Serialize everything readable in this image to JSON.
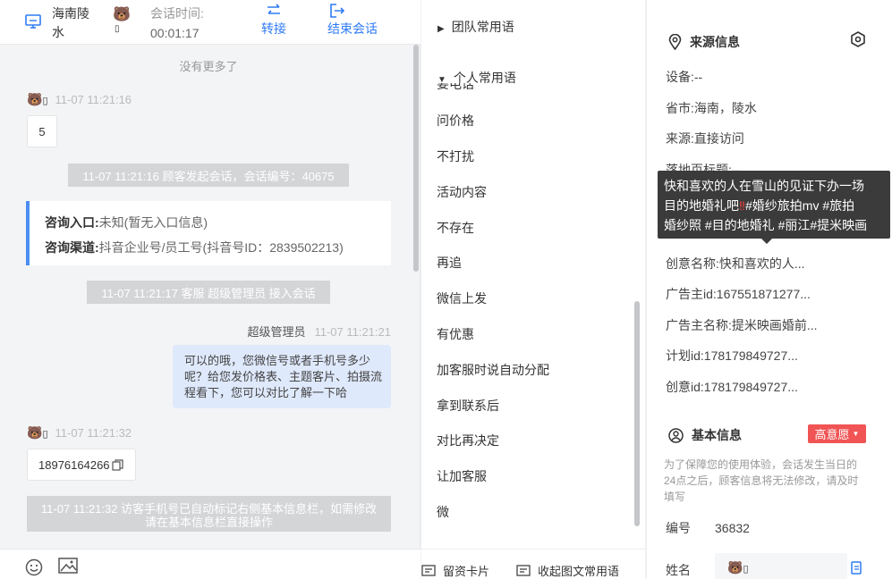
{
  "header": {
    "customer_name": "海南陵水",
    "visitor_emoji": "🐻",
    "visitor_box": "▯",
    "session_time_label": "会话时间:",
    "session_time_value": "00:01:17",
    "transfer_label": "转接",
    "end_label": "结束会话"
  },
  "chat": {
    "no_more": "没有更多了",
    "visitor_emoji": "🐻",
    "visitor_box": "▯",
    "messages": [
      {
        "time": "11-07 11:21:16",
        "text": "5"
      },
      {
        "system": "11-07 11:21:16 顾客发起会话，会话编号：40675"
      },
      {
        "entry_label": "咨询入口:",
        "entry_value": "未知(暂无入口信息)",
        "channel_label": "咨询渠道:",
        "channel_value": "抖音企业号/员工号(抖音号ID：2839502213)"
      },
      {
        "system": "11-07 11:21:17 客服 超级管理员 接入会话"
      },
      {
        "agent": "超级管理员",
        "time": "11-07 11:21:21",
        "text": "可以的哦，您微信号或者手机号多少呢？给您发价格表、主题客片、拍摄流程看下，您可以对比了解一下哈"
      },
      {
        "time": "11-07 11:21:32",
        "text": "18976164266"
      },
      {
        "system": "11-07 11:21:32 访客手机号已自动标记右侧基本信息栏，如需修改请在基本信息栏直接操作"
      }
    ]
  },
  "phrases": {
    "team_group": "团队常用语",
    "personal_group": "个人常用语",
    "cut_item": "要电话",
    "items": [
      "问价格",
      "不打扰",
      "活动内容",
      "不存在",
      "再追",
      "微信上发",
      "有优惠",
      "加客服时说自动分配",
      "拿到联系后",
      "对比再决定",
      "让加客服",
      "微"
    ],
    "footer_card": "留资卡片",
    "footer_collapse": "收起图文常用语"
  },
  "source": {
    "title": "来源信息",
    "fields": [
      {
        "label": "设备:",
        "value": "--"
      },
      {
        "label": "省市:",
        "value": "海南，陵水"
      },
      {
        "label": "来源:",
        "value": "直接访问"
      },
      {
        "label": "落地页标题:",
        "value": "--"
      },
      {
        "label": "创意名称:",
        "value": "快和喜欢的人..."
      },
      {
        "label": "广告主id:",
        "value": "167551871277..."
      },
      {
        "label": "广告主名称:",
        "value": "提米映画婚前..."
      },
      {
        "label": "计划id:",
        "value": "178179849727..."
      },
      {
        "label": "创意id:",
        "value": "178179849727..."
      }
    ],
    "tooltip_line1": "快和喜欢的人在雪山的见证下办一场",
    "tooltip_line2a": "目的地婚礼吧",
    "tooltip_line2b": "‼",
    "tooltip_line2c": "#婚纱旅拍mv #旅拍",
    "tooltip_line3": "婚纱照 #目的地婚礼 #丽江#提米映画"
  },
  "basic": {
    "title": "基本信息",
    "intent_label": "高意愿",
    "note": "为了保障您的使用体验，会话发生当日的24点之后，顾客信息将无法修改，请及时填写",
    "id_label": "编号",
    "id_value": "36832",
    "name_label": "姓名",
    "name_emoji": "🐻",
    "name_box": "▯"
  },
  "colors": {
    "accent": "#2f7bf5",
    "intent": "#f05454",
    "agent_bubble": "#dfe9fc",
    "system_bg": "#d4d5d7"
  }
}
